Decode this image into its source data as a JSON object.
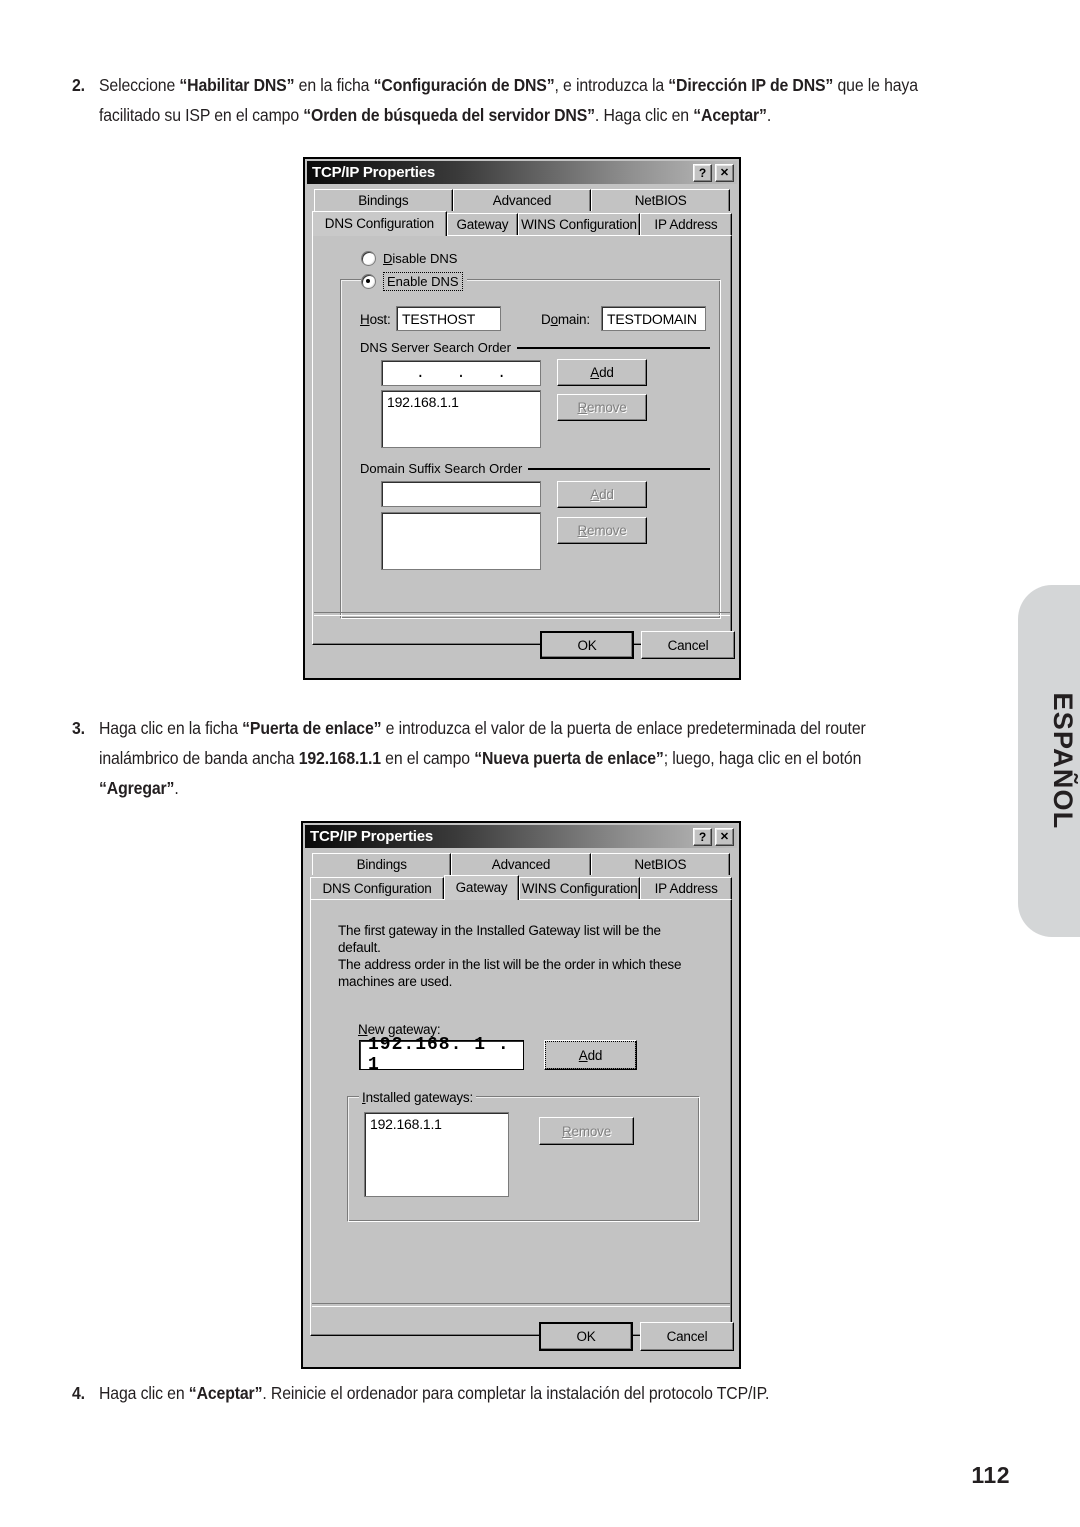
{
  "page": {
    "number": "112",
    "language_tab": "ESPAÑOL"
  },
  "steps": [
    {
      "num": "2.",
      "html": "Seleccione <b>“Habilitar DNS”</b> en la ficha <b>“Configuración de DNS”</b>, e introduzca la <b>“Dirección IP de DNS”</b> que le haya facilitado su ISP en el campo <b>“Orden de búsqueda del servidor DNS”</b>. Haga clic en <b>“Aceptar”</b>."
    },
    {
      "num": "3.",
      "html": "Haga clic en la ficha <b>“Puerta de enlace”</b> e introduzca el valor de la puerta de enlace predeterminada del router inalámbrico de banda ancha <b>192.168.1.1</b> en el campo <b>“Nueva puerta de enlace”</b>; luego, haga clic en el botón <b>“Agregar”</b>."
    },
    {
      "num": "4.",
      "html": "Haga clic en <b>“Aceptar”</b>. Reinicie el ordenador para completar la instalación del protocolo TCP/IP."
    }
  ],
  "dialog_dns": {
    "title": "TCP/IP Properties",
    "help_button": "?",
    "close_button": "✕",
    "tabs_row1": [
      "Bindings",
      "Advanced",
      "NetBIOS"
    ],
    "tabs_row2": [
      "DNS Configuration",
      "Gateway",
      "WINS Configuration",
      "IP Address"
    ],
    "active_tab": "DNS Configuration",
    "radio_disable": "Disable DNS",
    "radio_enable": "Enable DNS",
    "radio_selected": "Enable DNS",
    "host_label": "Host:",
    "host_value": "TESTHOST",
    "domain_label": "Domain:",
    "domain_value": "TESTDOMAIN",
    "dns_group_label": "DNS Server Search Order",
    "dns_ip_value": ".   .   .",
    "dns_list_value": "192.168.1.1",
    "dns_add_label": "Add",
    "dns_remove_label": "Remove",
    "suffix_group_label": "Domain Suffix Search Order",
    "suffix_input_value": "",
    "suffix_list_value": "",
    "suffix_add_label": "Add",
    "suffix_remove_label": "Remove",
    "ok_label": "OK",
    "cancel_label": "Cancel"
  },
  "dialog_gateway": {
    "title": "TCP/IP Properties",
    "help_button": "?",
    "close_button": "✕",
    "tabs_row1": [
      "Bindings",
      "Advanced",
      "NetBIOS"
    ],
    "tabs_row2": [
      "DNS Configuration",
      "Gateway",
      "WINS Configuration",
      "IP Address"
    ],
    "active_tab": "Gateway",
    "description": "The first gateway in the Installed Gateway list will be the default.\nThe address order in the list will be the order in which these\nmachines are used.",
    "new_gateway_label": "New gateway:",
    "new_gateway_value": "192.168. 1 . 1",
    "add_label": "Add",
    "installed_group_label": "Installed gateways:",
    "installed_list_value": "192.168.1.1",
    "remove_label": "Remove",
    "ok_label": "OK",
    "cancel_label": "Cancel"
  }
}
